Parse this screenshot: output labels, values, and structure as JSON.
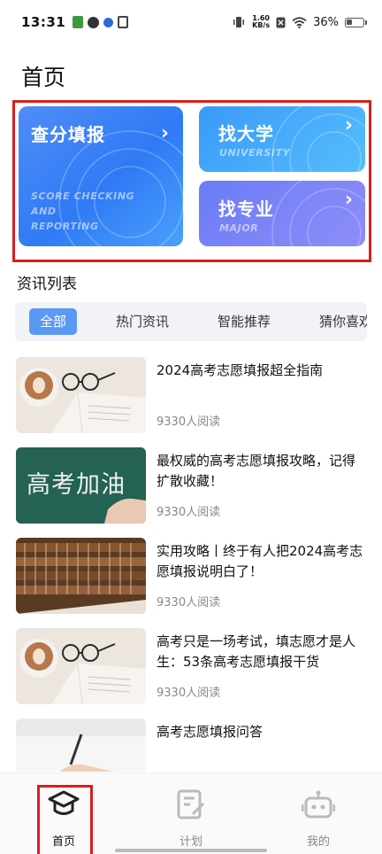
{
  "status_bar": {
    "time": "13:31",
    "speed_value": "1.60",
    "speed_unit": "KB/s",
    "battery_percent": "36%",
    "battery_level": 0.36
  },
  "page_title": "首页",
  "hero": {
    "main_card": {
      "title": "查分填报",
      "subtitle_line1": "SCORE CHECKING",
      "subtitle_line2": "AND",
      "subtitle_line3": "REPORTING"
    },
    "university_card": {
      "title": "找大学",
      "subtitle": "UNIVERSITY"
    },
    "major_card": {
      "title": "找专业",
      "subtitle": "MAJOR"
    },
    "chevron": "›"
  },
  "section_title": "资讯列表",
  "tabs": [
    {
      "label": "全部",
      "active": true
    },
    {
      "label": "热门资讯",
      "active": false
    },
    {
      "label": "智能推荐",
      "active": false
    },
    {
      "label": "猜你喜欢",
      "active": false
    }
  ],
  "news": [
    {
      "title": "2024高考志愿填报超全指南",
      "reads": "9330人阅读",
      "thumb": "coffee-book"
    },
    {
      "title": "最权威的高考志愿填报攻略，记得扩散收藏！",
      "reads": "9330人阅读",
      "thumb": "chalkboard"
    },
    {
      "title": "实用攻略丨终于有人把2024高考志愿填报说明白了！",
      "reads": "9330人阅读",
      "thumb": "library"
    },
    {
      "title": "高考只是一场考试，填志愿才是人生：53条高考志愿填报干货",
      "reads": "9330人阅读",
      "thumb": "coffee-book"
    },
    {
      "title": "高考志愿填报问答",
      "reads": "",
      "thumb": "writing"
    }
  ],
  "chalkboard_text": "高考加油",
  "bottom_nav": [
    {
      "label": "首页",
      "icon": "graduation-cap-icon",
      "active": true
    },
    {
      "label": "计划",
      "icon": "plan-edit-icon",
      "active": false
    },
    {
      "label": "我的",
      "icon": "robot-icon",
      "active": false
    }
  ],
  "colors": {
    "accent": "#5a98f5",
    "highlight_frame": "#d81e1e",
    "card_main": "#2f7af5",
    "card_university": "#46aefb",
    "card_major": "#7b84f7"
  }
}
